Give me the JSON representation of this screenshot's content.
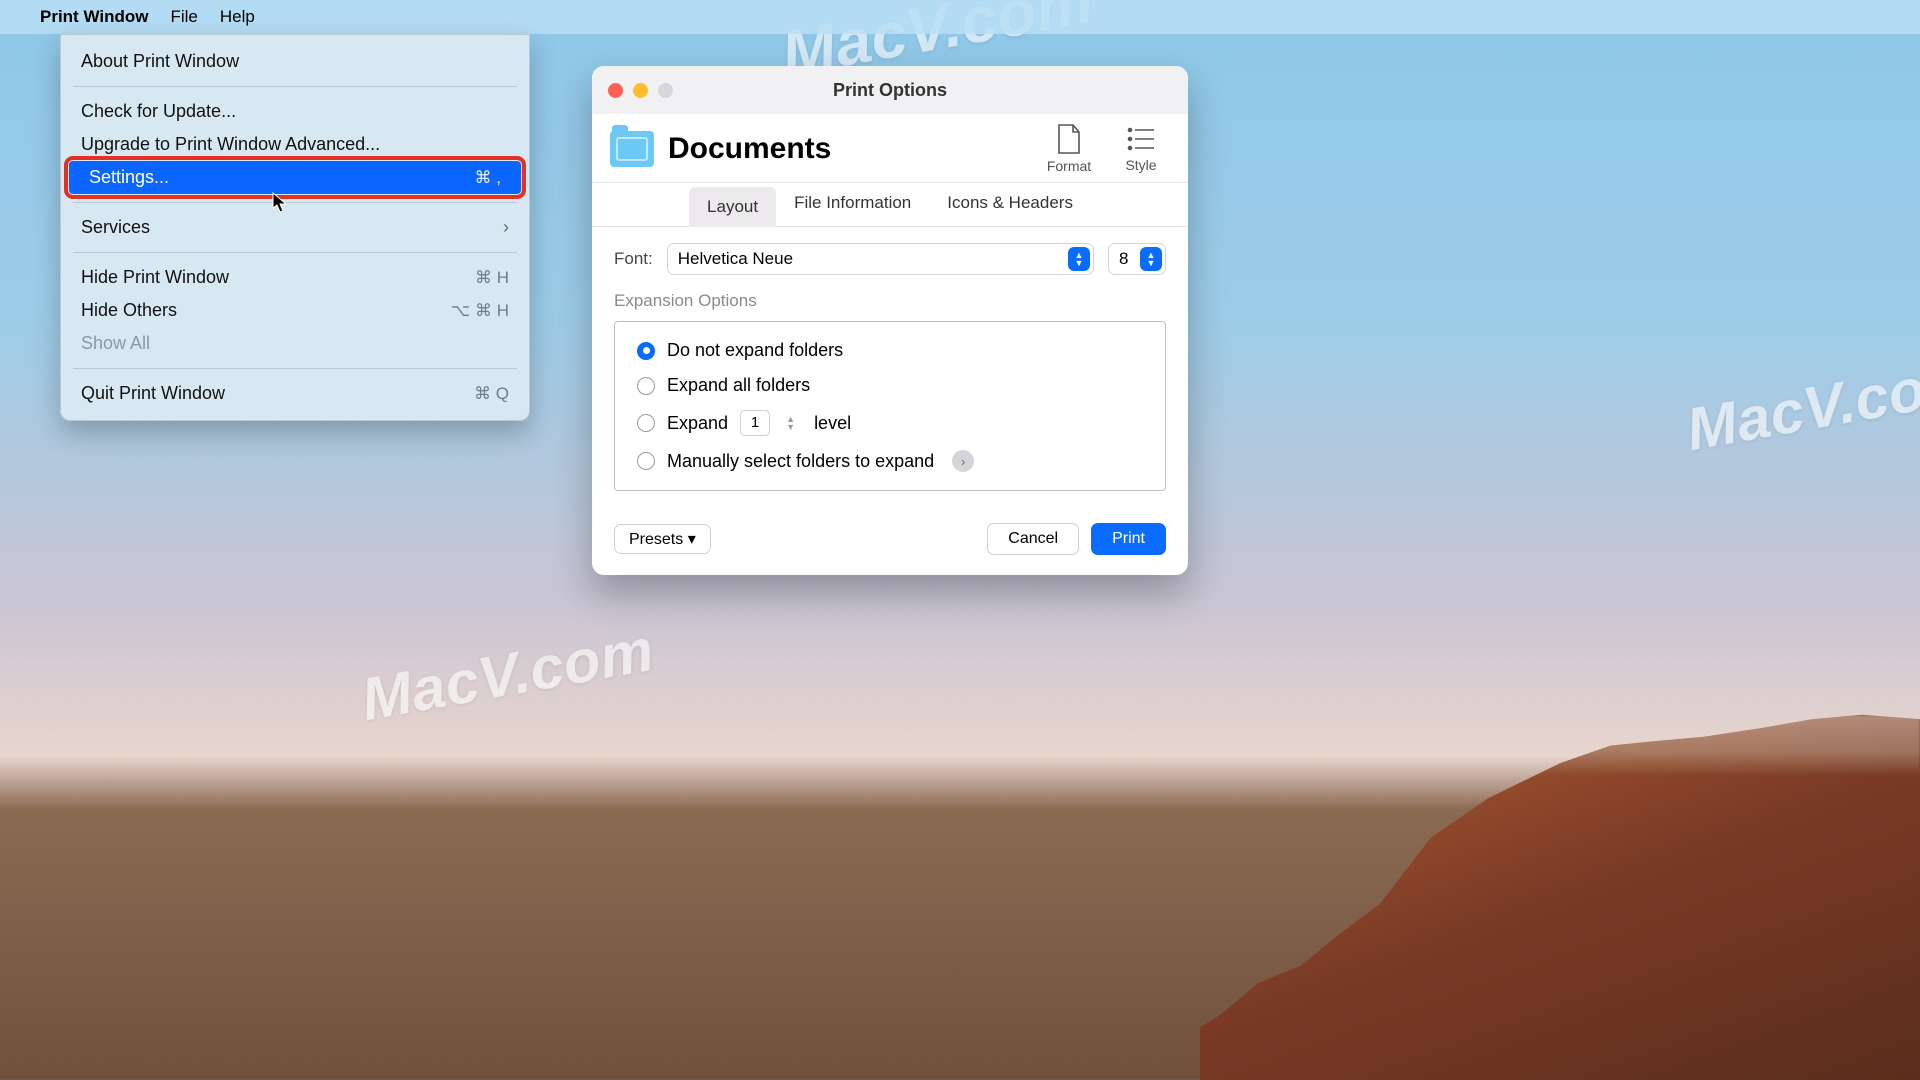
{
  "watermark_text": "MacV.com",
  "menubar": {
    "app": "Print Window",
    "items": [
      "File",
      "Help"
    ]
  },
  "appmenu": {
    "about": "About Print Window",
    "check_update": "Check for Update...",
    "upgrade": "Upgrade to Print Window Advanced...",
    "settings": "Settings...",
    "settings_shortcut": "⌘ ,",
    "services": "Services",
    "hide_app": "Hide Print Window",
    "hide_app_shortcut": "⌘ H",
    "hide_others": "Hide Others",
    "hide_others_shortcut": "⌥ ⌘ H",
    "show_all": "Show All",
    "quit": "Quit Print Window",
    "quit_shortcut": "⌘ Q"
  },
  "dialog": {
    "title": "Print Options",
    "heading": "Documents",
    "toolbar": {
      "format": "Format",
      "style": "Style"
    },
    "tabs": {
      "layout": "Layout",
      "file_info": "File Information",
      "icons_headers": "Icons & Headers"
    },
    "font_label": "Font:",
    "font_value": "Helvetica Neue",
    "font_size": "8",
    "expansion_label": "Expansion Options",
    "opts": {
      "no_expand": "Do not expand folders",
      "expand_all": "Expand all folders",
      "expand_pre": "Expand",
      "expand_level_value": "1",
      "expand_post": "level",
      "manual": "Manually select folders to expand"
    },
    "presets": "Presets ▾",
    "cancel": "Cancel",
    "print": "Print"
  }
}
